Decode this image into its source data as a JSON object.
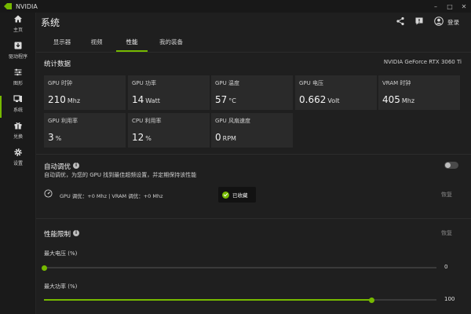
{
  "app": {
    "title": "NVIDIA"
  },
  "window_controls": {
    "minimize": "–",
    "maximize": "□",
    "close": "✕"
  },
  "sidebar": {
    "items": [
      {
        "label": "主页",
        "icon": "home-icon"
      },
      {
        "label": "驱动程序",
        "icon": "download-icon"
      },
      {
        "label": "图形",
        "icon": "sliders-icon"
      },
      {
        "label": "系统",
        "icon": "system-icon",
        "active": true
      },
      {
        "label": "兑换",
        "icon": "gift-icon"
      },
      {
        "label": "设置",
        "icon": "gear-icon"
      }
    ]
  },
  "header": {
    "title": "系统",
    "login": "登录"
  },
  "tabs": [
    {
      "label": "显示器"
    },
    {
      "label": "视频"
    },
    {
      "label": "性能",
      "active": true
    },
    {
      "label": "我的装备"
    }
  ],
  "stats": {
    "title": "统计数据",
    "gpu_name": "NVIDIA GeForce RTX 3060 Ti",
    "cards": [
      {
        "label": "GPU 时钟",
        "value": "210",
        "unit": "Mhz"
      },
      {
        "label": "GPU 功率",
        "value": "14",
        "unit": "Watt"
      },
      {
        "label": "GPU 温度",
        "value": "57",
        "unit": "°C"
      },
      {
        "label": "GPU 电压",
        "value": "0.662",
        "unit": "Volt"
      },
      {
        "label": "VRAM 时钟",
        "value": "405",
        "unit": "Mhz"
      },
      {
        "label": "GPU 利用率",
        "value": "3",
        "unit": "%"
      },
      {
        "label": "CPU 利用率",
        "value": "12",
        "unit": "%"
      },
      {
        "label": "GPU 风扇速度",
        "value": "0",
        "unit": "RPM"
      }
    ]
  },
  "auto_tune": {
    "title": "自动调优",
    "description": "自动调优，为您的 GPU 找到最佳超频设置，并定期保持该性能",
    "status": "GPU 调优：+0 Mhz   |   VRAM 调优：+0 Mhz",
    "restore": "恢复",
    "enabled": false
  },
  "toast": {
    "label": "已收藏"
  },
  "perf_limit": {
    "title": "性能限制",
    "restore": "恢复",
    "sliders": [
      {
        "label": "最大电压 (%)",
        "value": "0",
        "fraction": 0
      },
      {
        "label": "最大功率 (%)",
        "value": "100",
        "fraction": 0.835
      }
    ]
  },
  "colors": {
    "accent": "#76b900",
    "background": "#1f1f1f",
    "card": "#2a2a2a"
  }
}
